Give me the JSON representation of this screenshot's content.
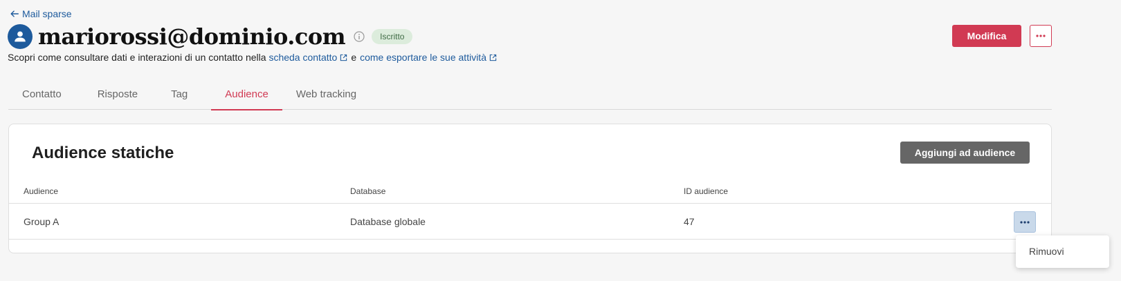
{
  "header": {
    "back_link": "Mail sparse",
    "title": "mariorossi@dominio.com",
    "status_badge": "Iscritto",
    "subtitle_prefix": "Scopri come consultare dati e interazioni di un contatto nella",
    "subtitle_link1": "scheda contatto",
    "subtitle_sep": "e",
    "subtitle_link2": "come esportare le sue attività",
    "edit_button": "Modifica"
  },
  "tabs": [
    {
      "label": "Contatto"
    },
    {
      "label": "Risposte"
    },
    {
      "label": "Tag"
    },
    {
      "label": "Audience"
    },
    {
      "label": "Web tracking"
    }
  ],
  "active_tab": "Audience",
  "card": {
    "title": "Audience statiche",
    "add_button": "Aggiungi ad audience",
    "columns": [
      "Audience",
      "Database",
      "ID audience"
    ],
    "rows": [
      {
        "audience": "Group A",
        "database": "Database globale",
        "id": "47"
      }
    ]
  },
  "row_menu": {
    "items": [
      "Rimuovi"
    ]
  },
  "colors": {
    "accent": "#d13a53",
    "link": "#1d5a9c",
    "badge_bg": "#dcecdc",
    "badge_text": "#3f6b44"
  }
}
